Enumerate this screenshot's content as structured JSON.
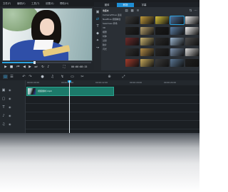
{
  "menu": [
    "文件(F)",
    "编辑(E)",
    "工具(T)",
    "设置(S)",
    "帮助(H)"
  ],
  "preview": {
    "transport_icons": [
      "play-icon",
      "stop-icon",
      "rewind-icon",
      "prev-frame-icon",
      "next-frame-icon",
      "fast-forward-icon",
      "repeat-icon",
      "volume-icon"
    ],
    "timecode": "00:00:08:15",
    "scrub_progress": 0.36
  },
  "library": {
    "tabs": [
      "媒体",
      "转场",
      "字幕"
    ],
    "active_tab": 1,
    "categories": [
      "收藏夹",
      "Camera/Move 连接",
      "NewBlue 视频精选",
      "Seamless 转场",
      "3D",
      "相册",
      "时钟",
      "过滤",
      "胶片",
      "闪光"
    ],
    "selected_category": 0,
    "thumbnails": [
      {
        "color": "#3a3a3a"
      },
      {
        "color": "#c29b3b"
      },
      {
        "color": "#d8c23c"
      },
      {
        "color": "#4c6f9a"
      },
      {
        "color": "#e8e8e8"
      },
      {
        "color": "#222222"
      },
      {
        "color": "#b6a06d"
      },
      {
        "color": "#1a1a1a"
      },
      {
        "color": "#5d7fa4"
      },
      {
        "color": "#f1f1f1"
      },
      {
        "color": "#6d2b2b"
      },
      {
        "color": "#c9b270"
      },
      {
        "color": "#2b2b2b"
      },
      {
        "color": "#9bb5cf"
      },
      {
        "color": "#4d4d4d"
      },
      {
        "color": "#303030"
      },
      {
        "color": "#b38c47"
      },
      {
        "color": "#262626"
      },
      {
        "color": "#7c92ad"
      },
      {
        "color": "#dcdcdc"
      },
      {
        "color": "#a33b2b"
      },
      {
        "color": "#c6a85b"
      },
      {
        "color": "#3b3b3b"
      },
      {
        "color": "#5a7694"
      },
      {
        "color": "#1f1f1f"
      }
    ]
  },
  "toolbar_icons": [
    "storyboard-icon",
    "timeline-icon",
    "undo-icon",
    "redo-icon",
    "record-icon",
    "mixer-icon",
    "motion-icon",
    "subtitle-icon",
    "split-icon",
    "zoom-icon",
    "fit-icon"
  ],
  "timeline": {
    "ruler_labels": [
      "00:00:00:00",
      "00:00:06:00",
      "00:00:12:00",
      "00:00:18:00",
      "00:00:24:00"
    ],
    "tracks": [
      "video",
      "overlay",
      "title",
      "voice",
      "music"
    ],
    "clip": {
      "label": "视频素材.mp4"
    }
  },
  "colors": {
    "accent": "#2aa2e0",
    "clip": "#1c7a6a",
    "panel": "#22262b"
  }
}
